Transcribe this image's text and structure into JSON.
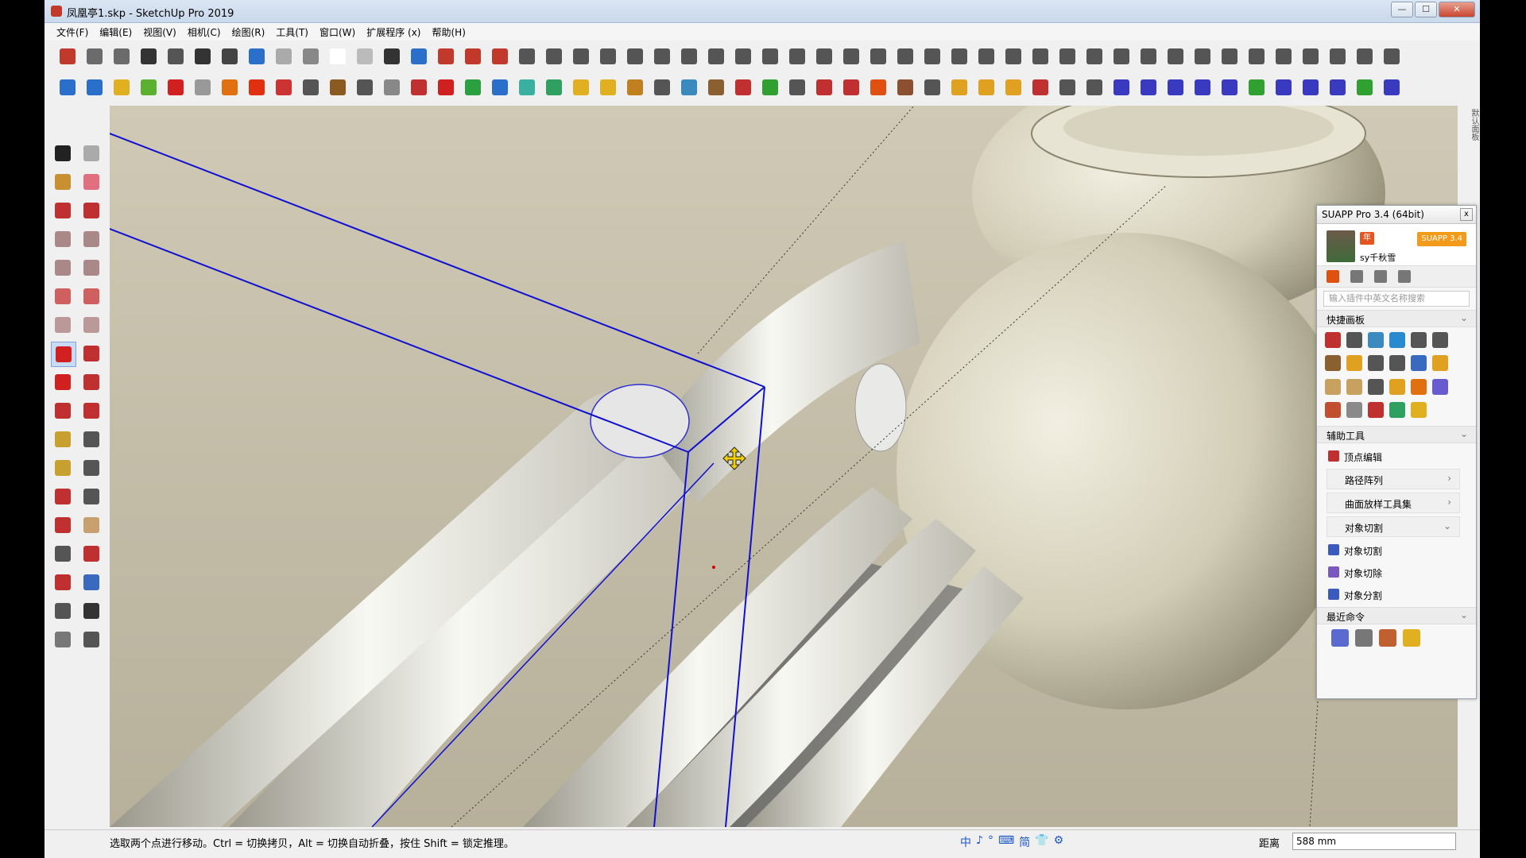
{
  "window": {
    "title": "凤凰亭1.skp - SketchUp Pro 2019",
    "controls": {
      "minimize": "—",
      "maximize": "☐",
      "close": "✕"
    }
  },
  "menu": [
    "文件(F)",
    "编辑(E)",
    "视图(V)",
    "相机(C)",
    "绘图(R)",
    "工具(T)",
    "窗口(W)",
    "扩展程序 (x)",
    "帮助(H)"
  ],
  "toolbar1_icons": [
    "#c0392b",
    "#6b6b6b",
    "#6b6b6b",
    "#333333",
    "#555555",
    "#333333",
    "#444444",
    "#2a6fc9",
    "#aaaaaa",
    "#888888",
    "#ffffff",
    "#bbbbbb",
    "#333333",
    "#2a6fc9",
    "#c0392b",
    "#c0392b",
    "#c0392b",
    "#555555",
    "#555555",
    "#555555",
    "#555555",
    "#555555",
    "#555555",
    "#555555",
    "#555555",
    "#555555",
    "#555555",
    "#555555",
    "#555555",
    "#555555",
    "#555555",
    "#555555",
    "#555555",
    "#555555",
    "#555555",
    "#555555",
    "#555555",
    "#555555",
    "#555555",
    "#555555",
    "#555555",
    "#555555",
    "#555555",
    "#555555",
    "#555555",
    "#555555",
    "#555555",
    "#555555",
    "#555555",
    "#555555"
  ],
  "toolbar2_icons": [
    "#2a6fc9",
    "#2a6fc9",
    "#e0b020",
    "#5cb030",
    "#d02020",
    "#999999",
    "#e07010",
    "#e03010",
    "#cc3333",
    "#555555",
    "#8a5a20",
    "#555555",
    "#888888",
    "#c03030",
    "#d02020",
    "#2aa040",
    "#2a6fc9",
    "#3ab0a0",
    "#30a060",
    "#e0b020",
    "#e0b020",
    "#c08020",
    "#555555",
    "#3a8ac0",
    "#8a6030",
    "#c03030",
    "#30a030",
    "#555555",
    "#c03030",
    "#c03030",
    "#e05010",
    "#8a5030",
    "#555555",
    "#e0a020",
    "#e0a020",
    "#e0a020",
    "#c03030",
    "#555555",
    "#555555",
    "#3a3ac0",
    "#3a3ac0",
    "#3a3ac0",
    "#3a3ac0",
    "#3a3ac0",
    "#30a030",
    "#3a3ac0",
    "#3a3ac0",
    "#3a3ac0",
    "#30a030",
    "#3a3ac0"
  ],
  "left_tools": [
    {
      "name": "select",
      "color": "#222222"
    },
    {
      "name": "component",
      "color": "#aaaaaa"
    },
    {
      "name": "paint",
      "color": "#c89030"
    },
    {
      "name": "eraser",
      "color": "#e07080"
    },
    {
      "name": "line",
      "color": "#c03030"
    },
    {
      "name": "freehand",
      "color": "#c03030"
    },
    {
      "name": "rectangle",
      "color": "#aa8888"
    },
    {
      "name": "rotated-rect",
      "color": "#aa8888"
    },
    {
      "name": "circle",
      "color": "#aa8888"
    },
    {
      "name": "polygon",
      "color": "#aa8888"
    },
    {
      "name": "arc",
      "color": "#d06060"
    },
    {
      "name": "arc2",
      "color": "#d06060"
    },
    {
      "name": "pie",
      "color": "#bb9999"
    },
    {
      "name": "arc3",
      "color": "#bb9999"
    },
    {
      "name": "move",
      "color": "#d02020"
    },
    {
      "name": "push-pull",
      "color": "#c03030"
    },
    {
      "name": "rotate",
      "color": "#d02020"
    },
    {
      "name": "follow-me",
      "color": "#c03030"
    },
    {
      "name": "scale",
      "color": "#c03030"
    },
    {
      "name": "offset",
      "color": "#c03030"
    },
    {
      "name": "tape",
      "color": "#c8a030"
    },
    {
      "name": "dimension",
      "color": "#555555"
    },
    {
      "name": "protractor",
      "color": "#c8a030"
    },
    {
      "name": "text",
      "color": "#555555"
    },
    {
      "name": "axes",
      "color": "#c03030"
    },
    {
      "name": "3d-text",
      "color": "#555555"
    },
    {
      "name": "orbit",
      "color": "#c03030"
    },
    {
      "name": "pan",
      "color": "#c8a070"
    },
    {
      "name": "zoom",
      "color": "#555555"
    },
    {
      "name": "zoom-window",
      "color": "#c03030"
    },
    {
      "name": "zoom-extents",
      "color": "#c03030"
    },
    {
      "name": "zoom-prev",
      "color": "#3a6ac0"
    },
    {
      "name": "position-camera",
      "color": "#555555"
    },
    {
      "name": "look-around",
      "color": "#333333"
    },
    {
      "name": "walk",
      "color": "#777777"
    },
    {
      "name": "section",
      "color": "#555555"
    }
  ],
  "side_strip": "默认面板",
  "suapp": {
    "title": "SUAPP Pro 3.4 (64bit)",
    "close": "x",
    "user_name": "sy千秋雪",
    "vip_badge": "年",
    "version_badge": "SUAPP 3.4",
    "icon_colors": [
      "#e05010",
      "#777777",
      "#777777",
      "#777777"
    ],
    "search_placeholder": "输入插件中英文名称搜索",
    "quick_panel": "快捷画板",
    "quick_icons": [
      "#c03030",
      "#555555",
      "#3a8ac0",
      "#2a8ad0",
      "#555555",
      "#555555",
      "#8a6030",
      "#e0a020",
      "#555555",
      "#555555",
      "#3a6ac0",
      "#e0a020",
      "#c8a060",
      "#c8a060",
      "#555555",
      "#e0a020",
      "#e07010",
      "#6a5ad0",
      "#c05030",
      "#8a8a8a",
      "#c03030",
      "#30a060",
      "#e0b020"
    ],
    "aux_tools": "辅助工具",
    "list": [
      {
        "label": "顶点编辑",
        "icon": "#c03030",
        "arrow": ""
      },
      {
        "label": "路径阵列",
        "icon": "",
        "arrow": "›"
      },
      {
        "label": "曲面放样工具集",
        "icon": "",
        "arrow": "›"
      },
      {
        "label": "对象切割",
        "icon": "",
        "arrow": "⌄"
      },
      {
        "label": "对象切割",
        "icon": "#3a5ac0",
        "arrow": ""
      },
      {
        "label": "对象切除",
        "icon": "#7a5ac0",
        "arrow": ""
      },
      {
        "label": "对象分割",
        "icon": "#3a5ac0",
        "arrow": ""
      }
    ],
    "recent": "最近命令",
    "recent_icons": [
      "#5a6ad0",
      "#777777",
      "#c06030",
      "#e0b020"
    ]
  },
  "status": {
    "hint": "选取两个点进行移动。Ctrl = 切换拷贝，Alt = 切换自动折叠，按住 Shift = 锁定推理。",
    "ime": [
      "中",
      "♪",
      "°",
      "⌨",
      "简",
      "👕",
      "⚙"
    ],
    "distance_label": "距离",
    "distance_value": "588 mm"
  }
}
